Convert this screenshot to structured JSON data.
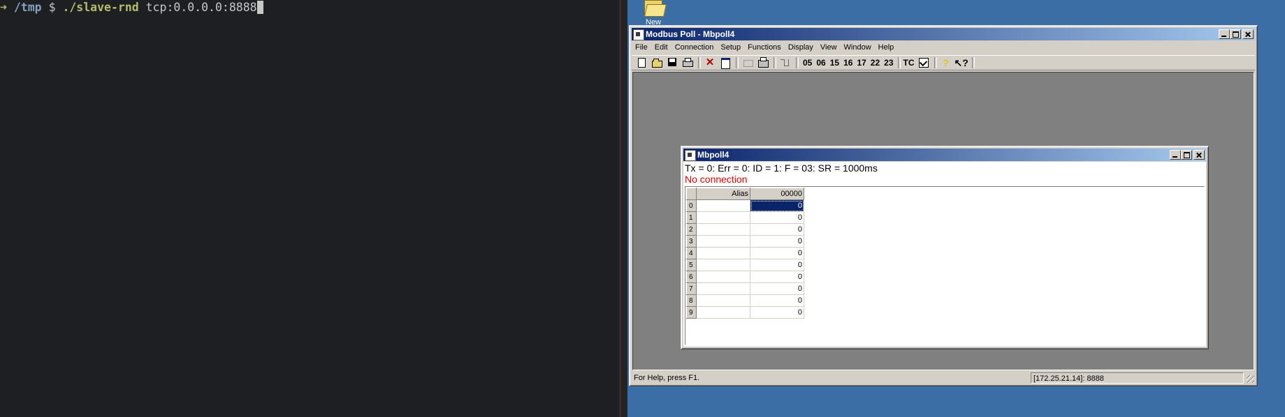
{
  "terminal": {
    "arrow": "➜",
    "cwd": "/tmp",
    "prompt": "$",
    "command": "./slave-rnd",
    "argument": "tcp:0.0.0.0:8888"
  },
  "desktop": {
    "folder_label": "New"
  },
  "app": {
    "title": "Modbus Poll - Mbpoll4",
    "menu": [
      "File",
      "Edit",
      "Connection",
      "Setup",
      "Functions",
      "Display",
      "View",
      "Window",
      "Help"
    ],
    "function_codes": [
      "05",
      "06",
      "15",
      "16",
      "17",
      "22",
      "23"
    ],
    "tc_label": "TC",
    "status": {
      "help": "For Help, press F1.",
      "connection": "[172.25.21.14]: 8888"
    }
  },
  "child": {
    "title": "Mbpoll4",
    "info": "Tx = 0: Err = 0: ID = 1: F = 03: SR = 1000ms",
    "status": "No connection",
    "grid": {
      "headers": [
        "Alias",
        "00000"
      ],
      "rows": [
        {
          "index": "0",
          "alias": "",
          "value": "0"
        },
        {
          "index": "1",
          "alias": "",
          "value": "0"
        },
        {
          "index": "2",
          "alias": "",
          "value": "0"
        },
        {
          "index": "3",
          "alias": "",
          "value": "0"
        },
        {
          "index": "4",
          "alias": "",
          "value": "0"
        },
        {
          "index": "5",
          "alias": "",
          "value": "0"
        },
        {
          "index": "6",
          "alias": "",
          "value": "0"
        },
        {
          "index": "7",
          "alias": "",
          "value": "0"
        },
        {
          "index": "8",
          "alias": "",
          "value": "0"
        },
        {
          "index": "9",
          "alias": "",
          "value": "0"
        }
      ],
      "selected_row": "0"
    }
  },
  "colors": {
    "desktop": "#3a6ea5",
    "terminal_bg": "#1e1f22",
    "titlebar": "#0a246a",
    "error_text": "#e00000"
  }
}
